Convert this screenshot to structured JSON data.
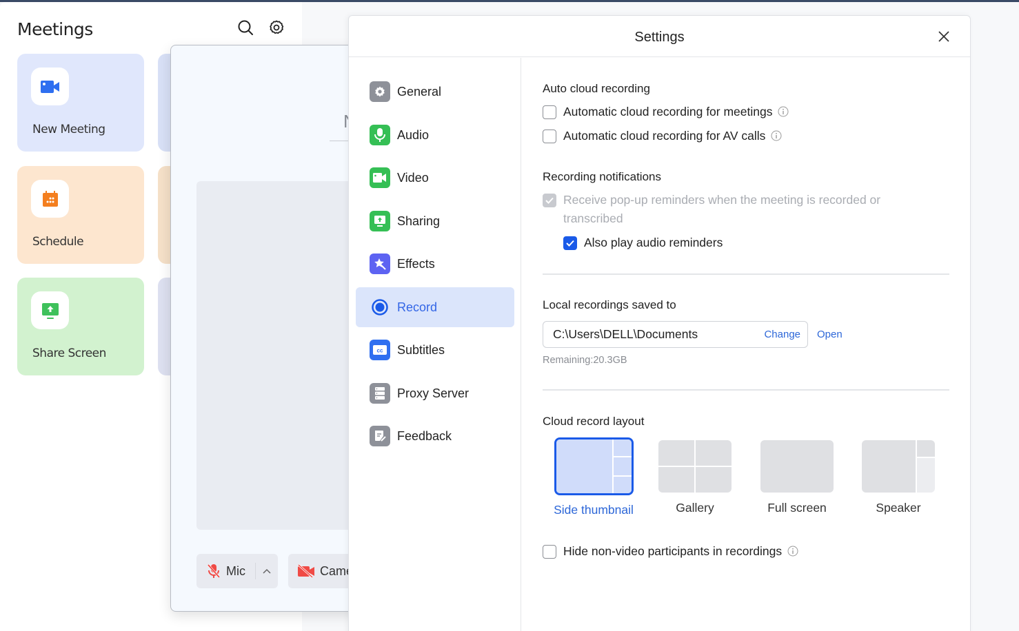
{
  "meetings": {
    "title": "Meetings",
    "header_icons": [
      "search-icon",
      "gear-icon"
    ],
    "cards": [
      {
        "label": "New Meeting",
        "icon": "video-camera-icon",
        "bg": "#e0e7fc",
        "accent": "#2f6ff0"
      },
      {
        "label": "Schedule",
        "icon": "calendar-icon",
        "bg": "#fde6cf",
        "accent": "#f47f1f"
      },
      {
        "label": "Share Screen",
        "icon": "share-screen-icon",
        "bg": "#d2f2cf",
        "accent": "#3ec15b"
      }
    ]
  },
  "preview": {
    "name_fragment": "N",
    "mic_label": "Mic",
    "camera_label": "Came"
  },
  "settings": {
    "title": "Settings",
    "nav": [
      {
        "label": "General",
        "icon": "gear-icon",
        "color": "#8e9199"
      },
      {
        "label": "Audio",
        "icon": "microphone-icon",
        "color": "#35bf55"
      },
      {
        "label": "Video",
        "icon": "video-camera-icon",
        "color": "#35bf55"
      },
      {
        "label": "Sharing",
        "icon": "share-screen-icon",
        "color": "#35bf55"
      },
      {
        "label": "Effects",
        "icon": "effects-star-icon",
        "color": "#5d63f2"
      },
      {
        "label": "Record",
        "icon": "record-icon",
        "color": "#1a5ae8",
        "active": true
      },
      {
        "label": "Subtitles",
        "icon": "cc-icon",
        "color": "#2f6ff0"
      },
      {
        "label": "Proxy Server",
        "icon": "server-icon",
        "color": "#8e9199"
      },
      {
        "label": "Feedback",
        "icon": "feedback-icon",
        "color": "#8e9199"
      }
    ],
    "record": {
      "auto_cloud": {
        "title": "Auto cloud recording",
        "options": [
          {
            "label": "Automatic cloud recording for meetings",
            "checked": false
          },
          {
            "label": "Automatic cloud recording for AV calls",
            "checked": false
          }
        ]
      },
      "notifications": {
        "title": "Recording notifications",
        "popup_label_line1": "Receive pop-up reminders when the meeting is recorded or",
        "popup_label_line2": "transcribed",
        "popup_checked": true,
        "popup_disabled": true,
        "audio_label": "Also play audio reminders",
        "audio_checked": true
      },
      "local": {
        "title": "Local recordings saved to",
        "path": "C:\\Users\\DELL\\Documents",
        "change_label": "Change",
        "open_label": "Open",
        "remaining": "Remaining:20.3GB"
      },
      "cloud_layout": {
        "title": "Cloud record layout",
        "options": [
          "Side thumbnail",
          "Gallery",
          "Full screen",
          "Speaker"
        ],
        "selected": "Side thumbnail"
      },
      "hide_nonvideo": {
        "label": "Hide non-video participants in recordings",
        "checked": false
      }
    }
  }
}
